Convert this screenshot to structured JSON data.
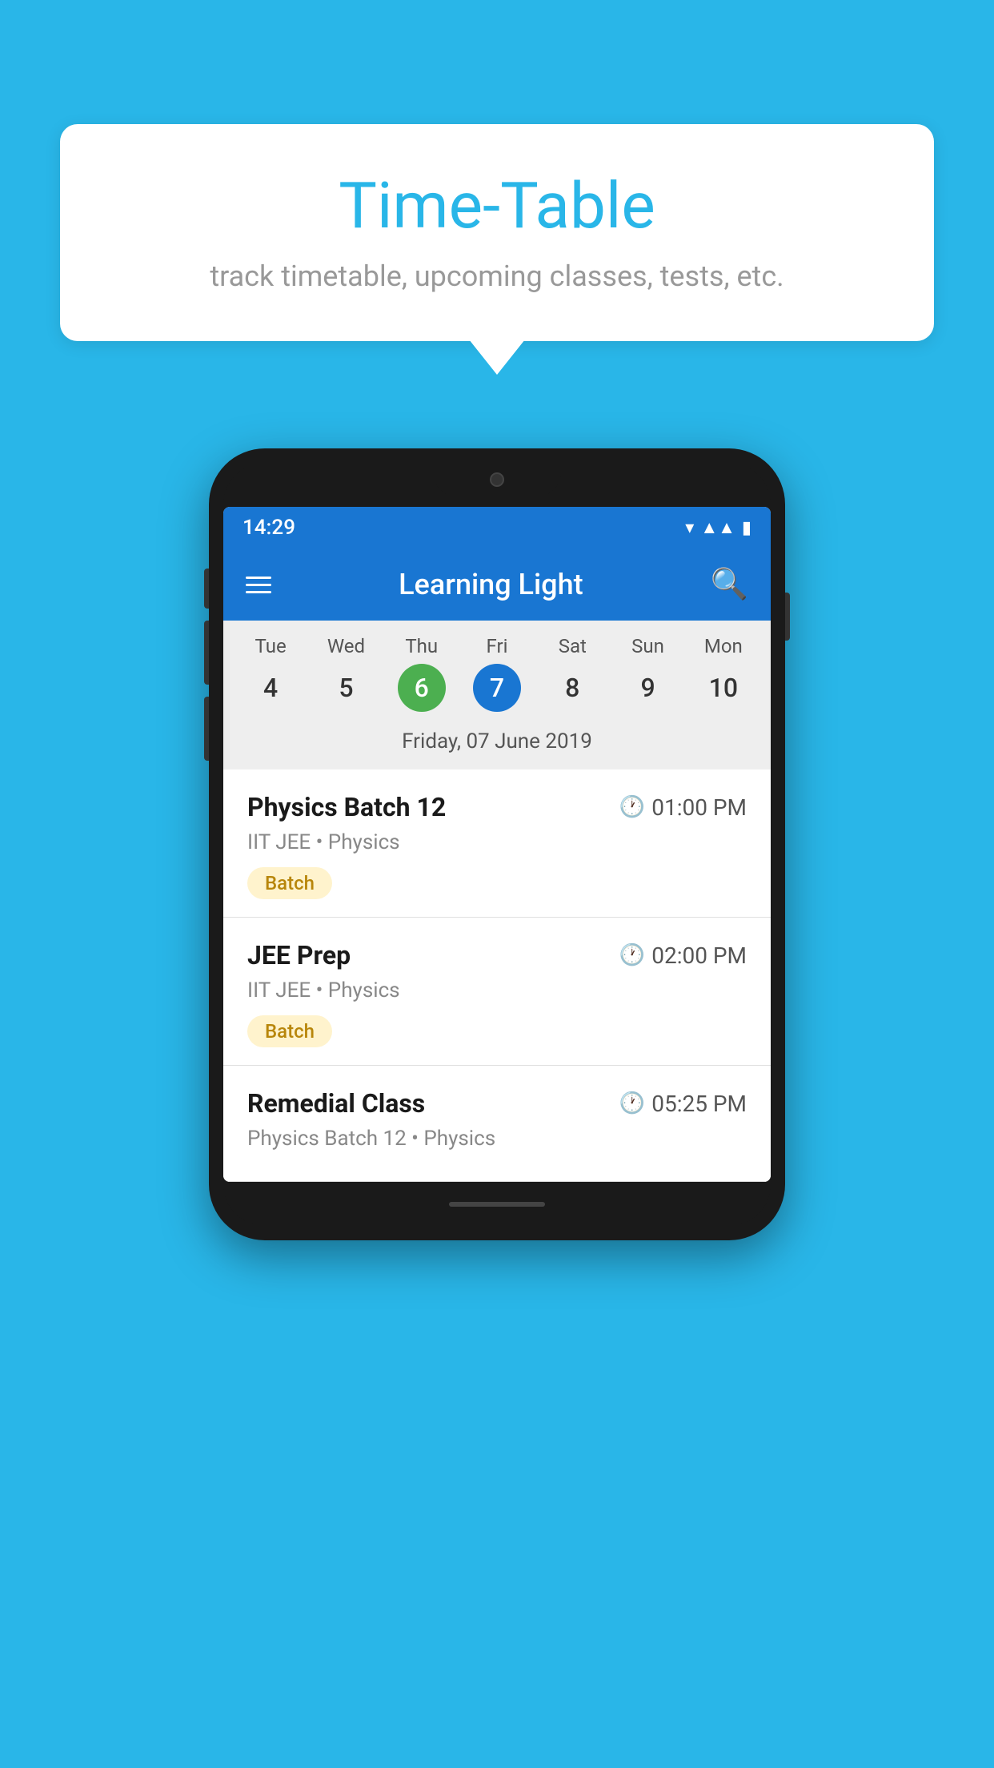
{
  "background_color": "#29b6e8",
  "bubble": {
    "title": "Time-Table",
    "subtitle": "track timetable, upcoming classes, tests, etc."
  },
  "phone": {
    "status_bar": {
      "time": "14:29"
    },
    "app_bar": {
      "title": "Learning Light"
    },
    "calendar": {
      "days": [
        {
          "name": "Tue",
          "num": "4",
          "state": "normal"
        },
        {
          "name": "Wed",
          "num": "5",
          "state": "normal"
        },
        {
          "name": "Thu",
          "num": "6",
          "state": "today"
        },
        {
          "name": "Fri",
          "num": "7",
          "state": "selected"
        },
        {
          "name": "Sat",
          "num": "8",
          "state": "normal"
        },
        {
          "name": "Sun",
          "num": "9",
          "state": "normal"
        },
        {
          "name": "Mon",
          "num": "10",
          "state": "normal"
        }
      ],
      "selected_date": "Friday, 07 June 2019"
    },
    "classes": [
      {
        "name": "Physics Batch 12",
        "time": "01:00 PM",
        "subject": "IIT JEE • Physics",
        "badge": "Batch"
      },
      {
        "name": "JEE Prep",
        "time": "02:00 PM",
        "subject": "IIT JEE • Physics",
        "badge": "Batch"
      },
      {
        "name": "Remedial Class",
        "time": "05:25 PM",
        "subject": "Physics Batch 12 • Physics",
        "badge": null
      }
    ]
  }
}
